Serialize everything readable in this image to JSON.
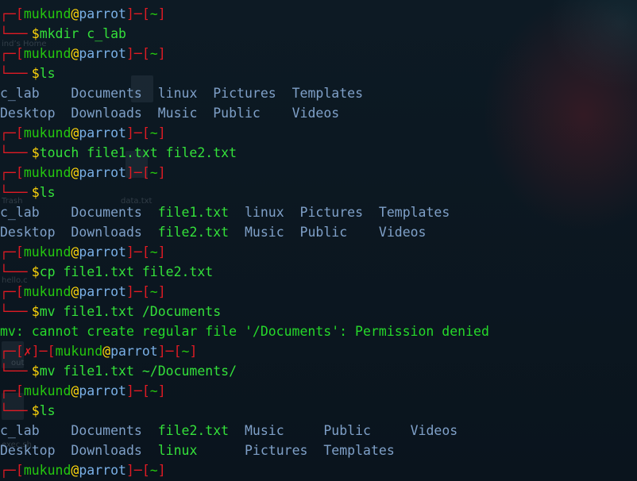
{
  "prompt": {
    "user": "mukund",
    "at": "@",
    "host": "parrot",
    "dir": "~",
    "error_mark": "✗"
  },
  "lines": [
    {
      "kind": "top"
    },
    {
      "kind": "cmd",
      "text": "mkdir c_lab"
    },
    {
      "kind": "top"
    },
    {
      "kind": "cmd",
      "text": "ls"
    },
    {
      "kind": "ls",
      "cols": [
        [
          "c_lab",
          "Desktop"
        ],
        [
          "Documents",
          "Downloads"
        ],
        [
          "linux",
          "Music"
        ],
        [
          "Pictures",
          "Public"
        ],
        [
          "Templates",
          "Videos"
        ]
      ],
      "widths": [
        9,
        11,
        7,
        10,
        10
      ]
    },
    {
      "kind": "ls2"
    },
    {
      "kind": "top"
    },
    {
      "kind": "cmd",
      "text": "touch file1.txt file2.txt"
    },
    {
      "kind": "top"
    },
    {
      "kind": "cmd",
      "text": "ls"
    },
    {
      "kind": "ls",
      "cols": [
        [
          "c_lab",
          "Desktop"
        ],
        [
          "Documents",
          "Downloads"
        ],
        [
          "file1.txt",
          "file2.txt"
        ],
        [
          "linux",
          "Music"
        ],
        [
          "Pictures",
          "Public"
        ],
        [
          "Templates",
          "Videos"
        ]
      ],
      "widths": [
        9,
        11,
        11,
        7,
        10,
        10
      ],
      "green_col": 2
    },
    {
      "kind": "ls2"
    },
    {
      "kind": "top"
    },
    {
      "kind": "cmd",
      "text": "cp file1.txt file2.txt"
    },
    {
      "kind": "top"
    },
    {
      "kind": "cmd",
      "text": "mv file1.txt /Documents"
    },
    {
      "kind": "out",
      "text": "mv: cannot create regular file '/Documents': Permission denied"
    },
    {
      "kind": "toperr"
    },
    {
      "kind": "cmd",
      "text": "mv file1.txt ~/Documents/"
    },
    {
      "kind": "top"
    },
    {
      "kind": "cmd",
      "text": "ls"
    },
    {
      "kind": "ls",
      "cols": [
        [
          "c_lab",
          "Desktop"
        ],
        [
          "Documents",
          "Downloads"
        ],
        [
          "file2.txt",
          "linux"
        ],
        [
          "Music",
          "Pictures"
        ],
        [
          "Public",
          "Templates"
        ],
        [
          "Videos",
          ""
        ]
      ],
      "widths": [
        9,
        11,
        11,
        10,
        11,
        10
      ],
      "green_col": 2
    },
    {
      "kind": "ls2"
    },
    {
      "kind": "top"
    }
  ],
  "desktop_ghosts": [
    {
      "label": "ind’s Home"
    },
    {
      "label": "data.txt"
    },
    {
      "label": "Trash"
    },
    {
      "label": "hello.c"
    },
    {
      "label": "out"
    },
    {
      "label": "exec.sh"
    }
  ],
  "colors": {
    "prompt_frame": "#e01b24",
    "user": "#25c60f",
    "at": "#ffd60a",
    "host": "#7ab0e6",
    "dollar": "#ffd60a",
    "command": "#34e03a",
    "dir_listing": "#7fa0c8",
    "file_listing": "#34e03a",
    "error_output": "#26d92a",
    "background": "#0b1620"
  }
}
